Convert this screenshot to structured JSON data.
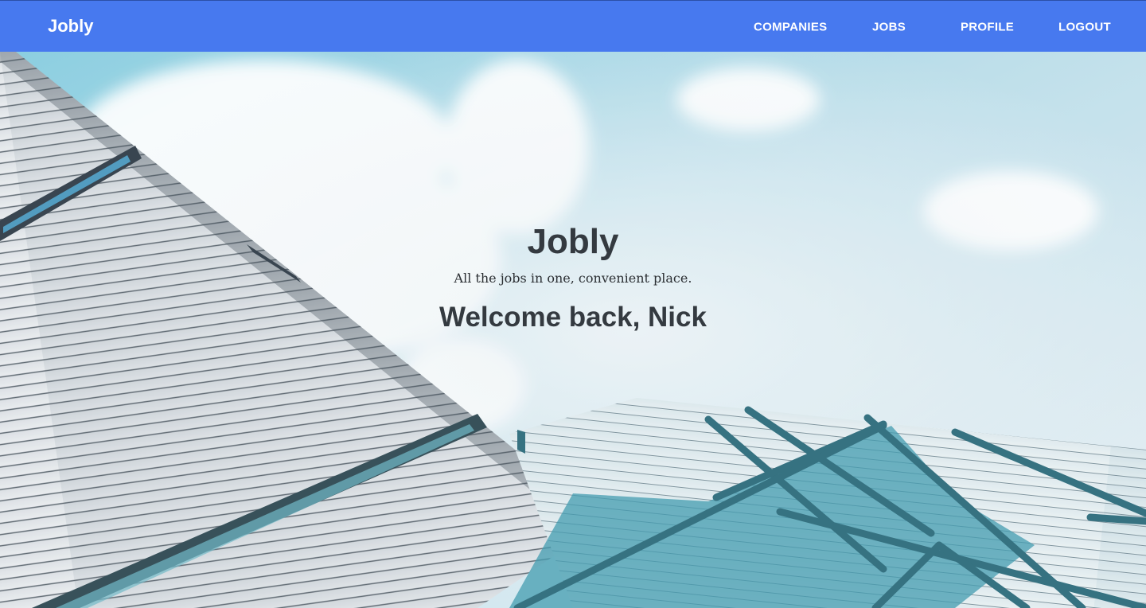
{
  "navbar": {
    "brand": "Jobly",
    "links": [
      {
        "label": "COMPANIES"
      },
      {
        "label": "JOBS"
      },
      {
        "label": "PROFILE"
      },
      {
        "label": "LOGOUT"
      }
    ],
    "color": "#4779ef"
  },
  "hero": {
    "title": "Jobly",
    "tagline": "All the jobs in one, convenient place.",
    "welcome": "Welcome back, Nick"
  }
}
